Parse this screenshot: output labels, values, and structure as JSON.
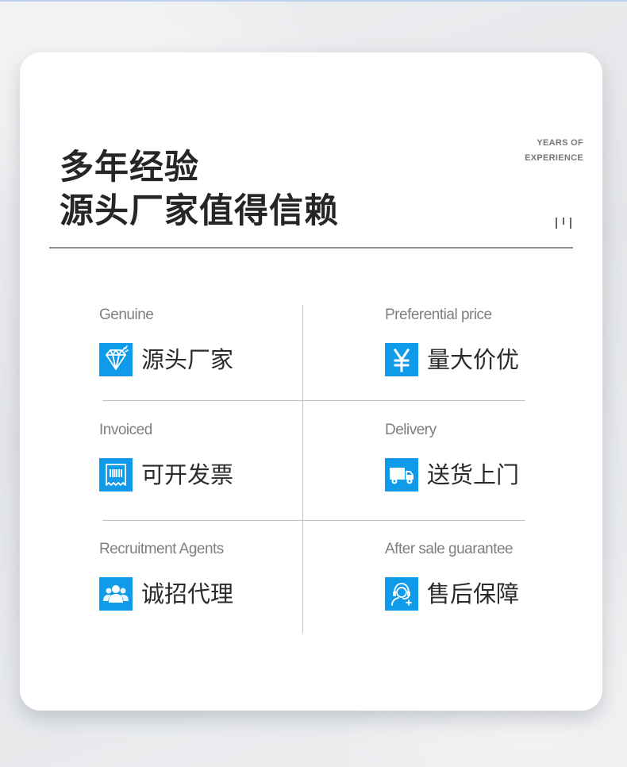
{
  "headline": {
    "line1": "多年经验",
    "line2": "源头厂家值得信赖"
  },
  "badge": {
    "line1": "YEARS OF",
    "line2": "EXPERIENCE"
  },
  "accent_color": "#0f9bea",
  "features": [
    {
      "en": "Genuine",
      "cn": "源头厂家",
      "icon": "diamond-icon"
    },
    {
      "en": "Preferential price",
      "cn": "量大价优",
      "icon": "yen-icon"
    },
    {
      "en": "Invoiced",
      "cn": "可开发票",
      "icon": "receipt-icon"
    },
    {
      "en": "Delivery",
      "cn": "送货上门",
      "icon": "truck-icon"
    },
    {
      "en": "Recruitment Agents",
      "cn": "诚招代理",
      "icon": "users-icon"
    },
    {
      "en": "After sale guarantee",
      "cn": "售后保障",
      "icon": "support-agent-icon"
    }
  ]
}
